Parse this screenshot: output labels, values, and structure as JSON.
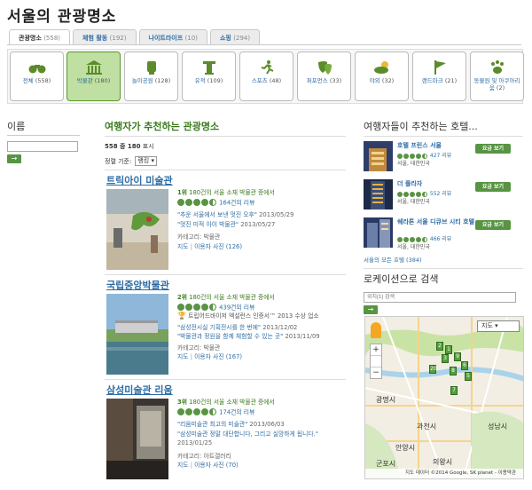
{
  "page": {
    "title": "서울의 관광명소"
  },
  "tabs": [
    {
      "label": "관광명소",
      "count": "(558)"
    },
    {
      "label": "체험 활동",
      "count": "(192)"
    },
    {
      "label": "나이트라이프",
      "count": "(10)"
    },
    {
      "label": "쇼핑",
      "count": "(294)"
    }
  ],
  "categories": [
    {
      "icon": "binoculars-icon",
      "glyph": "⌘",
      "label": "전체",
      "count": "(558)"
    },
    {
      "icon": "museum-icon",
      "glyph": "🏛",
      "label": "박물관",
      "count": "(180)"
    },
    {
      "icon": "ferris-wheel-icon",
      "glyph": "☸",
      "label": "놀이공원",
      "count": "(128)"
    },
    {
      "icon": "landmark-icon",
      "glyph": "♜",
      "label": "유적",
      "count": "(109)"
    },
    {
      "icon": "sports-icon",
      "glyph": "🏃",
      "label": "스포츠",
      "count": "(48)"
    },
    {
      "icon": "theater-masks-icon",
      "glyph": "☺",
      "label": "퍼포먼스",
      "count": "(33)"
    },
    {
      "icon": "outdoor-icon",
      "glyph": "☁",
      "label": "야외",
      "count": "(32)"
    },
    {
      "icon": "flag-icon",
      "glyph": "⚑",
      "label": "랜드마크",
      "count": "(21)"
    },
    {
      "icon": "paw-icon",
      "glyph": "❀",
      "label": "동물원 및 아쿠아리움",
      "count": "(2)"
    }
  ],
  "filter": {
    "title": "이름",
    "go_label": "→"
  },
  "list": {
    "heading": "여행자가 추천하는 관광명소",
    "shown_prefix": "558 중 180",
    "shown_suffix": " 표시",
    "sort_label": "정렬 기준:",
    "sort_value": "랭킹",
    "items": [
      {
        "name": "트릭아이 미술관",
        "rank": "1위",
        "rank_rest": "180건의 서울 소재 박물관 중에서",
        "rating": 4.5,
        "reviews": "164건의 리뷰",
        "award": "",
        "quote1": "\"추운 서울에서 보낸 멋진 오후\"",
        "date1": "2013/05/29",
        "quote2": "\"멋진 미적 아이 박물관\"",
        "date2": "2013/05/27",
        "category": "카테고리: 박물관",
        "map_link": "지도",
        "photos_link": "이용자 사진 (126)"
      },
      {
        "name": "국립중앙박물관",
        "rank": "2위",
        "rank_rest": "180건의 서울 소재 박물관 중에서",
        "rating": 4.5,
        "reviews": "439건의 리뷰",
        "award": "트립어드바이저 엑설런스 인증서™ 2013 수상 업소",
        "quote1": "\"삼성전시실 기획전시를 한 번에\"",
        "date1": "2013/12/02",
        "quote2": "\"박물관과 정원을 함께 체험할 수 있는 곳\"",
        "date2": "2013/11/09",
        "category": "카테고리: 박물관",
        "map_link": "지도",
        "photos_link": "이용자 사진 (167)"
      },
      {
        "name": "삼성미술관 리움",
        "rank": "3위",
        "rank_rest": "180건의 서울 소재 박물관 중에서",
        "rating": 4.5,
        "reviews": "174건의 리뷰",
        "award": "",
        "quote1": "\"리움미술관 최고의 미술관\"",
        "date1": "2013/06/03",
        "quote2": "\"삼성미술관 정말 대단합니다, 그리고 실망하게 됩니다.\"",
        "date2": "2013/01/25",
        "category": "카테고리: 아트갤러리",
        "map_link": "지도",
        "photos_link": "이용자 사진 (70)"
      }
    ]
  },
  "hotels": {
    "heading": "여행자들이 추천하는 호텔...",
    "items": [
      {
        "name": "호텔 프린스 서울",
        "rating": 4.5,
        "reviews": "427 리뷰",
        "location": "서울, 대한민국",
        "button": "요금 보기"
      },
      {
        "name": "더 플라자",
        "rating": 4.5,
        "reviews": "552 리뷰",
        "location": "서울, 대한민국",
        "button": "요금 보기"
      },
      {
        "name": "쉐라톤 서울 디큐브 시티 호텔",
        "rating": 4.5,
        "reviews": "466 리뷰",
        "location": "서울, 대한민국",
        "button": "요금 보기"
      }
    ],
    "all_link": "서울의 모든 호텔 (384)"
  },
  "locsearch": {
    "heading": "로케이션으로 검색",
    "placeholder": "위치(1) 검색",
    "go_label": "→"
  },
  "map": {
    "type_select": "지도",
    "zoom_in": "+",
    "zoom_out": "−",
    "cities": [
      "광명시",
      "과천시",
      "안양시",
      "성남시",
      "군포시",
      "의왕시"
    ],
    "attribution": "지도 데이터 ©2014 Google, SK planet - 이용약관",
    "marker_labels": [
      "2",
      "1",
      "3",
      "9",
      "20",
      "8",
      "7",
      "6",
      "5"
    ]
  },
  "colors": {
    "brand_green": "#589442",
    "link_blue": "#2e6da4",
    "heading_green": "#3b7b1e",
    "active_cat_bg": "#bfe0a2"
  }
}
